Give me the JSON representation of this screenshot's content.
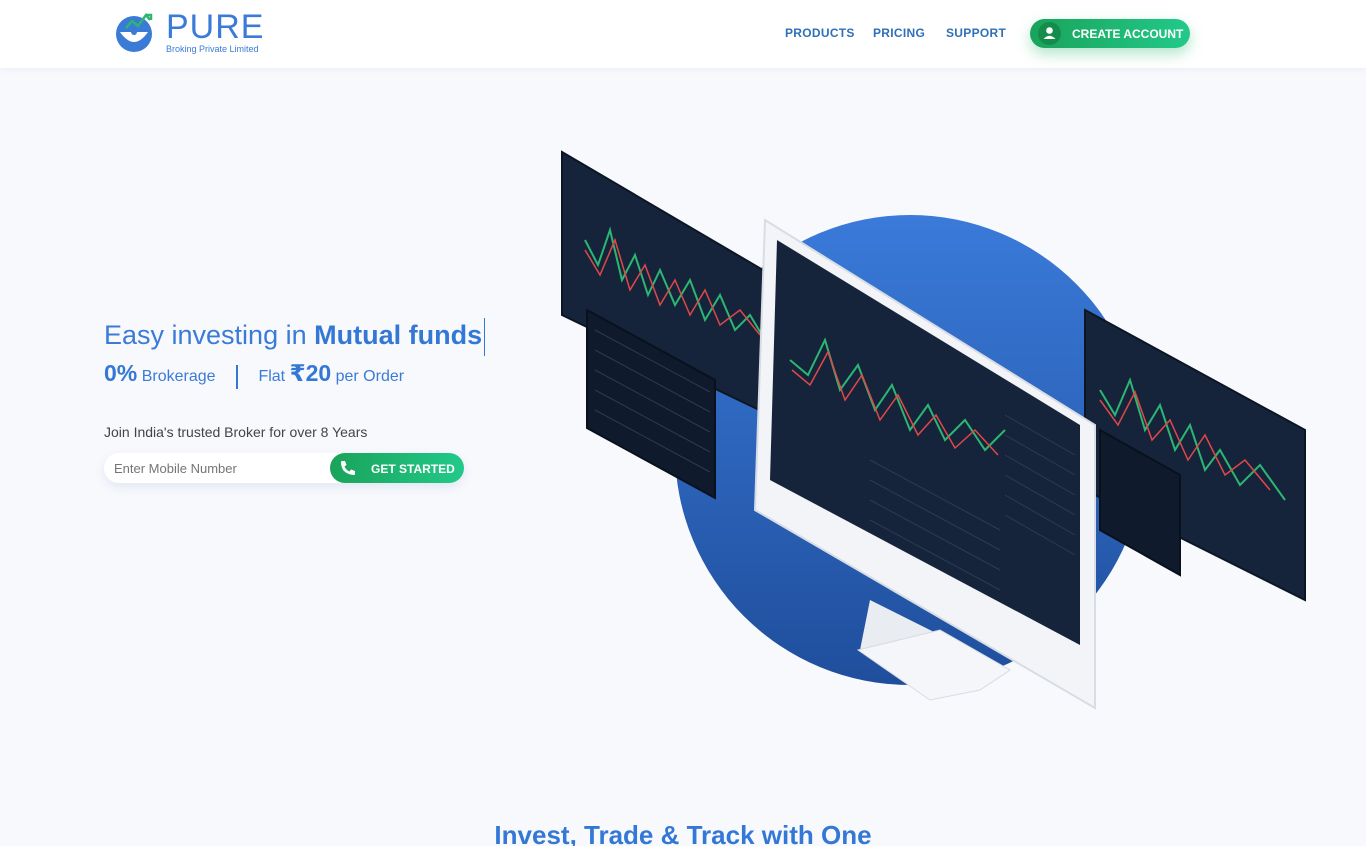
{
  "header": {
    "logo": {
      "word": "PURE",
      "subtitle": "Broking Private Limited"
    },
    "nav": [
      {
        "label": "PRODUCTS"
      },
      {
        "label": "PRICING"
      },
      {
        "label": "SUPPORT"
      }
    ],
    "cta": {
      "label": "CREATE ACCOUNT",
      "icon": "user-icon"
    }
  },
  "hero": {
    "headline_prefix": "Easy investing in ",
    "headline_highlight": "Mutual funds",
    "brokerage_value": "0%",
    "brokerage_label": "Brokerage",
    "flat_label": "Flat",
    "flat_value": "₹20",
    "per_order_label": "per Order",
    "tagline": "Join India's trusted Broker for over 8 Years",
    "mobile_placeholder": "Enter Mobile Number",
    "cta_label": "GET STARTED",
    "cta_icon": "phone-icon"
  },
  "section": {
    "title": "Invest, Trade & Track with One"
  },
  "colors": {
    "brand_blue": "#3478d6",
    "green_start": "#1aa35a",
    "green_end": "#22c98a",
    "dark_screen": "#16243b",
    "circle": "#2f6fcf"
  }
}
